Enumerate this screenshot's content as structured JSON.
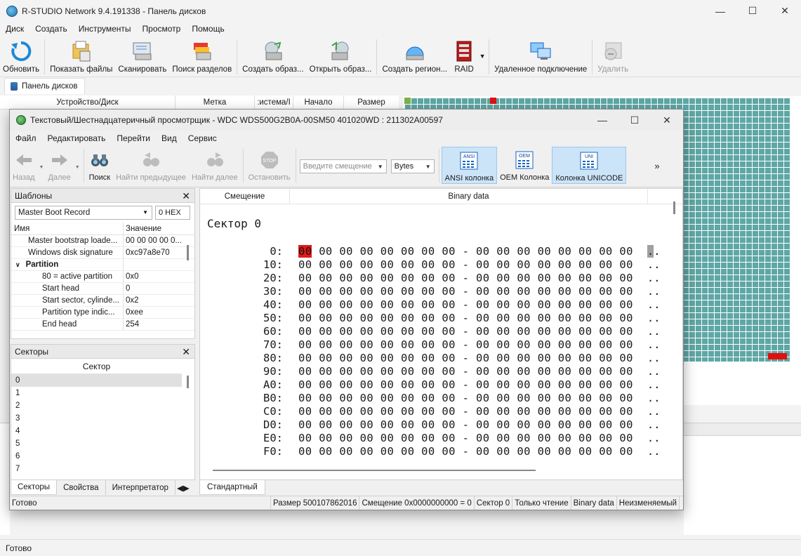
{
  "main": {
    "title": "R-STUDIO Network 9.4.191338 - Панель дисков",
    "menu": [
      "Диск",
      "Создать",
      "Инструменты",
      "Просмотр",
      "Помощь"
    ],
    "toolbar": {
      "refresh": "Обновить",
      "show_files": "Показать файлы",
      "scan": "Сканировать",
      "find_partitions": "Поиск разделов",
      "create_image": "Создать образ...",
      "open_image": "Открыть образ...",
      "create_region": "Создать регион...",
      "raid": "RAID",
      "remote_connection": "Удаленное подключение",
      "delete": "Удалить"
    },
    "panel_tab": "Панель дисков",
    "disk_columns": [
      "Устройство/Диск",
      "Метка",
      ":истема/I",
      "Начало",
      "Размер"
    ],
    "status": "Готово"
  },
  "viewer": {
    "title": "Текстовый/Шестнадцатеричный просмотрщик - WDC WDS500G2B0A-00SM50 401020WD : 211302A00597",
    "menu": [
      "Файл",
      "Редактировать",
      "Перейти",
      "Вид",
      "Сервис"
    ],
    "toolbar": {
      "back": "Назад",
      "forward": "Далее",
      "search": "Поиск",
      "find_prev": "Найти предыдущее",
      "find_next": "Найти далее",
      "stop": "Остановить",
      "offset_placeholder": "Введите смещение",
      "units": "Bytes",
      "ansi": "ANSI колонка",
      "oem": "OEM Колонка",
      "unicode": "Колонка UNICODE",
      "ansi_icon_label": "ANSI",
      "oem_icon_label": "OEM",
      "uni_icon_label": "UNI",
      "stop_icon_label": "STOP",
      "overflow": "»"
    },
    "templates": {
      "title": "Шаблоны",
      "selected": "Master Boot Record",
      "offset": "0 HEX",
      "col_name": "Имя",
      "col_value": "Значение",
      "rows": [
        {
          "name": "Master bootstrap loade...",
          "value": "00 00 00 00 0...",
          "indent": 1
        },
        {
          "name": "Windows disk signature",
          "value": "0xc97a8e70",
          "indent": 1
        },
        {
          "name": "Partition",
          "value": "",
          "indent": 0,
          "group": true
        },
        {
          "name": "80 = active partition",
          "value": "0x0",
          "indent": 2
        },
        {
          "name": "Start head",
          "value": "0",
          "indent": 2
        },
        {
          "name": "Start sector, cylinde...",
          "value": "0x2",
          "indent": 2
        },
        {
          "name": "Partition type indic...",
          "value": "0xee",
          "indent": 2
        },
        {
          "name": "End head",
          "value": "254",
          "indent": 2
        }
      ]
    },
    "sectors": {
      "title": "Секторы",
      "column": "Сектор",
      "items": [
        "0",
        "1",
        "2",
        "3",
        "4",
        "5",
        "6",
        "7"
      ]
    },
    "left_tabs": [
      "Секторы",
      "Свойства",
      "Интерпретатор"
    ],
    "hex": {
      "col_offset": "Смещение",
      "col_data": "Binary data",
      "sector_title": "Сектор 0",
      "rows": [
        {
          "offset": "0:",
          "bytes": "00 00 00 00 00 00 00 00 - 00 00 00 00 00 00 00 00",
          "ascii": ".."
        },
        {
          "offset": "10:",
          "bytes": "00 00 00 00 00 00 00 00 - 00 00 00 00 00 00 00 00",
          "ascii": ".."
        },
        {
          "offset": "20:",
          "bytes": "00 00 00 00 00 00 00 00 - 00 00 00 00 00 00 00 00",
          "ascii": ".."
        },
        {
          "offset": "30:",
          "bytes": "00 00 00 00 00 00 00 00 - 00 00 00 00 00 00 00 00",
          "ascii": ".."
        },
        {
          "offset": "40:",
          "bytes": "00 00 00 00 00 00 00 00 - 00 00 00 00 00 00 00 00",
          "ascii": ".."
        },
        {
          "offset": "50:",
          "bytes": "00 00 00 00 00 00 00 00 - 00 00 00 00 00 00 00 00",
          "ascii": ".."
        },
        {
          "offset": "60:",
          "bytes": "00 00 00 00 00 00 00 00 - 00 00 00 00 00 00 00 00",
          "ascii": ".."
        },
        {
          "offset": "70:",
          "bytes": "00 00 00 00 00 00 00 00 - 00 00 00 00 00 00 00 00",
          "ascii": ".."
        },
        {
          "offset": "80:",
          "bytes": "00 00 00 00 00 00 00 00 - 00 00 00 00 00 00 00 00",
          "ascii": ".."
        },
        {
          "offset": "90:",
          "bytes": "00 00 00 00 00 00 00 00 - 00 00 00 00 00 00 00 00",
          "ascii": ".."
        },
        {
          "offset": "A0:",
          "bytes": "00 00 00 00 00 00 00 00 - 00 00 00 00 00 00 00 00",
          "ascii": ".."
        },
        {
          "offset": "B0:",
          "bytes": "00 00 00 00 00 00 00 00 - 00 00 00 00 00 00 00 00",
          "ascii": ".."
        },
        {
          "offset": "C0:",
          "bytes": "00 00 00 00 00 00 00 00 - 00 00 00 00 00 00 00 00",
          "ascii": ".."
        },
        {
          "offset": "D0:",
          "bytes": "00 00 00 00 00 00 00 00 - 00 00 00 00 00 00 00 00",
          "ascii": ".."
        },
        {
          "offset": "E0:",
          "bytes": "00 00 00 00 00 00 00 00 - 00 00 00 00 00 00 00 00",
          "ascii": ".."
        },
        {
          "offset": "F0:",
          "bytes": "00 00 00 00 00 00 00 00 - 00 00 00 00 00 00 00 00",
          "ascii": ".."
        }
      ]
    },
    "hex_tab": "Стандартный",
    "status": {
      "ready": "Готово",
      "size": "Размер 500107862016",
      "offset": "Смещение 0x0000000000 = 0",
      "sector": "Сектор 0",
      "mode": "Только чтение",
      "view": "Binary data",
      "state": "Неизменяемый"
    }
  },
  "colors": {
    "map_cell": "#5ea7a5",
    "highlight": "#e21a1a",
    "active_button": "#cce4f7"
  }
}
